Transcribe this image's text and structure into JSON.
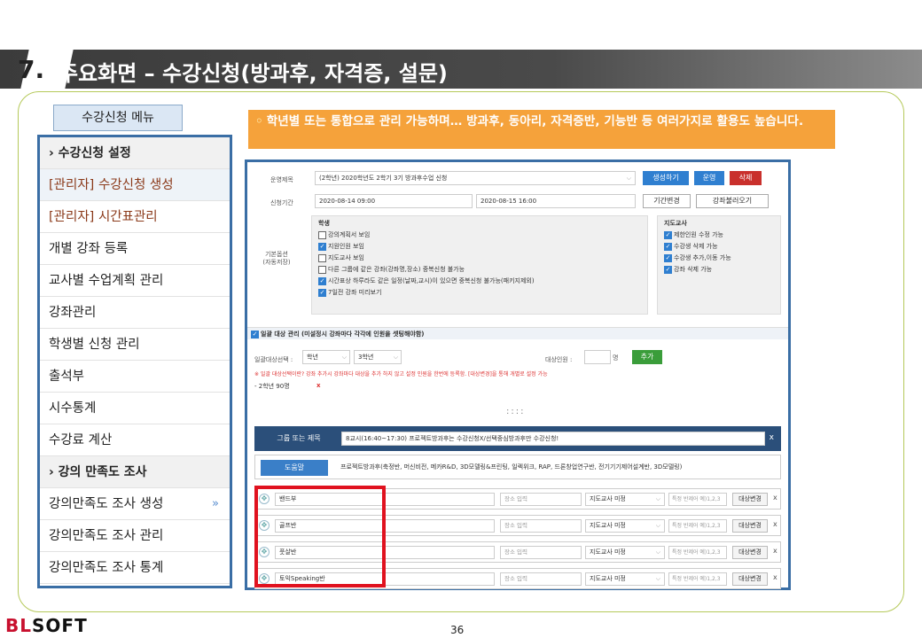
{
  "header": {
    "number": "7.",
    "title": "주요화면 – 수강신청(방과후, 자격증, 설문)"
  },
  "menu": {
    "title": "수강신청 메뉴",
    "items": [
      {
        "label": "› 수강신청 설정",
        "type": "head"
      },
      {
        "label": "[관리자] 수강신청 생성",
        "type": "admin"
      },
      {
        "label": "[관리자] 시간표관리",
        "type": "admin"
      },
      {
        "label": "개별 강좌 등록"
      },
      {
        "label": "교사별 수업계획 관리"
      },
      {
        "label": "강좌관리"
      },
      {
        "label": "학생별 신청 관리"
      },
      {
        "label": "출석부"
      },
      {
        "label": "시수통계"
      },
      {
        "label": "수강료 계산"
      },
      {
        "label": "› 강의 만족도 조사",
        "type": "head"
      },
      {
        "label": "강의만족도 조사 생성",
        "arrow": "»"
      },
      {
        "label": "강의만족도 조사 관리"
      },
      {
        "label": "강의만족도 조사 통계"
      }
    ]
  },
  "notice": {
    "bullet": "◦",
    "text": "학년별 또는 통합으로 관리 가능하며… 방과후, 동아리, 자격증반, 기능반 등 여러가지로 활용도 높습니다."
  },
  "form": {
    "op_label": "운영제목",
    "op_value": "(2학년) 2020학년도 2학기 3기 방과후수업 신청",
    "btn_create": "생성하기",
    "btn_run": "운영",
    "btn_delete": "삭제",
    "period_label": "신청기간",
    "period_start": "2020-08-14 09:00",
    "period_end": "2020-08-15 16:00",
    "btn_change": "기간변경",
    "btn_load": "강좌불러오기",
    "opt_label": "기본옵션\n(자동저장)",
    "student_title": "학생",
    "student_opts": [
      {
        "text": "강의계획서 보임",
        "on": false
      },
      {
        "text": "지원인원 보임",
        "on": true
      },
      {
        "text": "지도교사 보임",
        "on": false
      },
      {
        "text": "다른 그룹에 같은 강좌(강좌명,장소) 중복신청 불가능",
        "on": false
      },
      {
        "text": "시간표상 하루라도 같은 일정(날짜,교시)이 있으면 중복신청 불가능(패키지제외)",
        "on": true
      },
      {
        "text": "7일전 강좌 미리보기",
        "on": true
      }
    ],
    "teacher_title": "지도교사",
    "teacher_opts": [
      {
        "text": "제한인원 수정 가능",
        "on": true
      },
      {
        "text": "수강생 삭제 가능",
        "on": true
      },
      {
        "text": "수강생 추가,이동 가능",
        "on": true
      },
      {
        "text": "강좌 삭제 가능",
        "on": true
      }
    ],
    "bulk_title": "일괄 대상 관리 (미설정시 강좌마다 각각에 인원을 셋팅해야함)",
    "bulk_label": "일괄대상선택 :",
    "bulk_sel1": "학년",
    "bulk_sel2": "3학년",
    "target_label": "대상인원 :",
    "target_unit": "명",
    "btn_add": "추가",
    "warn": "※ 일괄 대상선택이란? 강좌 추가시 강좌마다 대상을 추가 하지 않고 설정 인원을 한번에 등록함. [대상변경]을 통해 개별로 설정 가능",
    "bulk_item": "- 2학년 90명",
    "bulk_x": "x",
    "dots": "::::",
    "group_label": "그룹 또는 제목",
    "group_value": "8교시(16:40~17:30) 프로젝트방과후는 수강신청X/선택중심방과후만 수강신청!",
    "group_x": "x",
    "help_label": "도움말",
    "help_text": "프로젝트방과후(축정반, 머신비전, 메카R&D, 3D모델링&프린팅, 일렉위크, RAP, 드론창업연구반, 전기기기제어설계반, 3D모델링)",
    "course_rows": [
      {
        "name": "밴드부",
        "place": "장소 입력",
        "teacher": "지도교사 미정",
        "cls": "특정 반제어 예)1,2,3",
        "btn": "대상변경",
        "x": "x"
      },
      {
        "name": "골프반",
        "place": "장소 입력",
        "teacher": "지도교사 미정",
        "cls": "특정 반제어 예)1,2,3",
        "btn": "대상변경",
        "x": "x"
      },
      {
        "name": "풋살반",
        "place": "장소 입력",
        "teacher": "지도교사 미정",
        "cls": "특정 반제어 예)1,2,3",
        "btn": "대상변경",
        "x": "x"
      },
      {
        "name": "토익Speaking반",
        "place": "장소 입력",
        "teacher": "지도교사 미정",
        "cls": "특정 반제어 예)1,2,3",
        "btn": "대상변경",
        "x": "x"
      }
    ]
  },
  "footer": {
    "logo_b": "BL",
    "logo_rest": "SOFT",
    "page": "36"
  }
}
